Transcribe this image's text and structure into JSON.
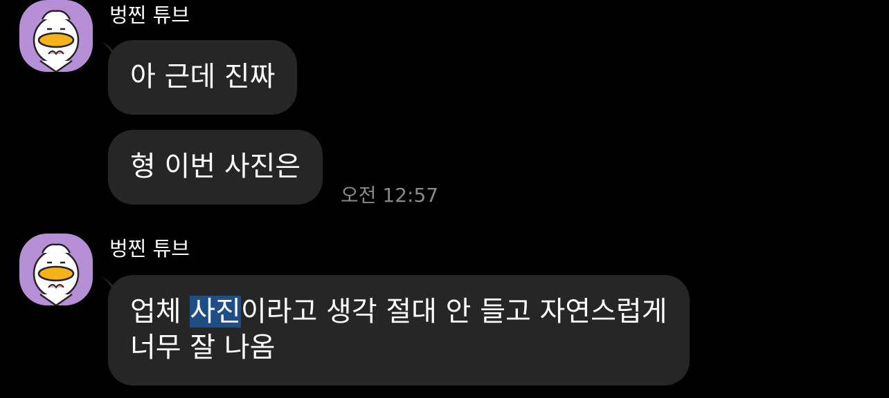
{
  "colors": {
    "background": "#000000",
    "bubble": "#262626",
    "avatar_bg": "#b78fd6",
    "highlight": "#1f4d86",
    "timestamp": "#8a8a8a"
  },
  "messages": [
    {
      "sender": "벙찐 튜브",
      "avatar_icon": "duck-character-icon",
      "bubbles": [
        "아 근데 진짜",
        "형 이번 사진은"
      ],
      "time": "오전 12:57"
    },
    {
      "sender": "벙찐 튜브",
      "avatar_icon": "duck-character-icon",
      "bubble_line1": {
        "before": "업체 ",
        "highlighted": "사진",
        "after": "이라고 생각 절대 안 들고 자연스럽게"
      },
      "bubble_line2": "너무 잘 나옴"
    }
  ]
}
